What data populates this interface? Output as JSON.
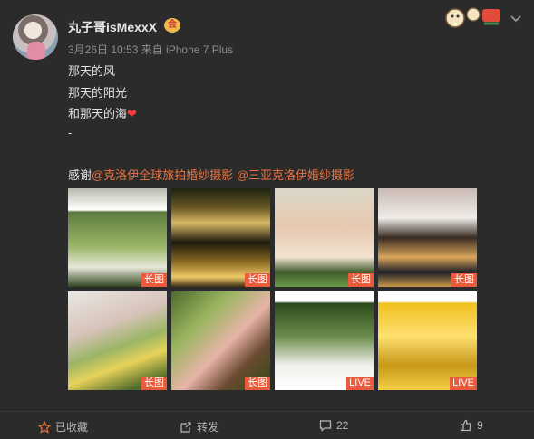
{
  "post": {
    "username": "丸子哥isMexxX",
    "vip_badge": "会",
    "meta": "3月26日 10:53 来自 iPhone 7 Plus",
    "lines": [
      "那天的风",
      "那天的阳光",
      "和那天的海",
      "-"
    ],
    "thanks_prefix": "感谢",
    "mention1": "@克洛伊全球旅拍婚纱摄影",
    "mention2": "@三亚克洛伊婚纱摄影"
  },
  "images": [
    {
      "tag": "长图"
    },
    {
      "tag": "长图"
    },
    {
      "tag": "长图"
    },
    {
      "tag": "长图"
    },
    {
      "tag": "长图"
    },
    {
      "tag": "长图"
    },
    {
      "tag": "LIVE"
    },
    {
      "tag": "LIVE"
    }
  ],
  "actions": {
    "favorite": "已收藏",
    "repost": "转发",
    "comments": "22",
    "likes": "9"
  },
  "colors": {
    "background": "#2b2b2b",
    "mention": "#eb7340",
    "tag": "#eb5a3b"
  },
  "icons": [
    "star-icon",
    "repost-icon",
    "comment-icon",
    "like-icon",
    "chevron-down-icon",
    "vip-icon"
  ]
}
